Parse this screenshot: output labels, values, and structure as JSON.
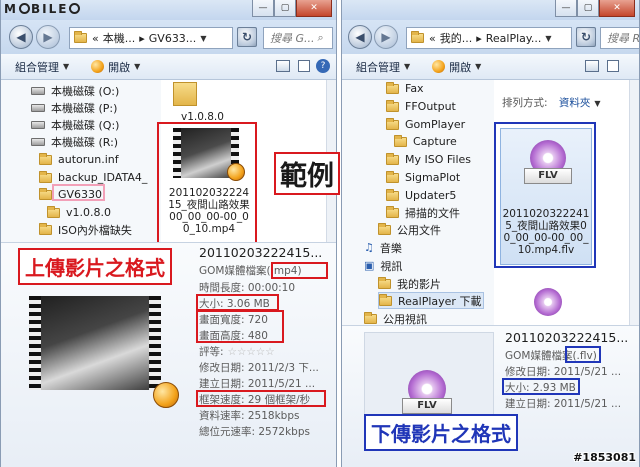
{
  "watermark": {
    "brand_pre": "M",
    "brand_post": "BILE",
    "code": "#1853081"
  },
  "left": {
    "address": {
      "part1": "本機...",
      "part2": "GV633..."
    },
    "search_placeholder": "搜尋 G...",
    "toolbar": {
      "organize": "組合管理",
      "open": "開啟"
    },
    "tree": [
      "本機磁碟 (O:)",
      "本機磁碟 (P:)",
      "本機磁碟 (Q:)",
      "本機磁碟 (R:)",
      "autorun.inf",
      "backup_IDATA4_",
      "GV6330",
      "v1.0.8.0",
      "ISO內外檔缺失"
    ],
    "content": {
      "folder_name": "v1.0.8.0",
      "file_name": "20110203222415_夜間山路效果00_00_00-00_00_10.mp4"
    },
    "details": {
      "name": "20110203222415...",
      "type": "GOM媒體檔案(.mp4)",
      "duration": "時間長度: 00:00:10",
      "size": "大小: 3.06 MB",
      "width": "畫面寬度: 720",
      "height": "畫面高度: 480",
      "rating": "評等:",
      "modified": "修改日期: 2011/2/3 下...",
      "created": "建立日期: 2011/5/21 ...",
      "framerate": "框架速度: 29 個框架/秒",
      "datarate": "資料速率: 2518kbps",
      "bitrate": "總位元速率: 2572kbps"
    }
  },
  "right": {
    "address": {
      "part1": "我的...",
      "part2": "RealPlay..."
    },
    "search_placeholder": "搜尋 R...",
    "toolbar": {
      "organize": "組合管理",
      "open": "開啟"
    },
    "sort": {
      "label": "排列方式:",
      "value": "資料夾"
    },
    "tree": [
      "Fax",
      "FFOutput",
      "GomPlayer",
      "Capture",
      "My ISO Files",
      "SigmaPlot",
      "Updater5",
      "掃描的文件",
      "公用文件",
      "音樂",
      "視訊",
      "我的影片",
      "RealPlayer 下載",
      "公用視訊"
    ],
    "content": {
      "file_name": "20110203222415_夜間山路效果00_00_00-00_00_10.mp4.flv",
      "icon_label": "FLV"
    },
    "details": {
      "name": "20110203222415...",
      "type": "GOM媒體檔案(.flv)",
      "modified": "修改日期: 2011/5/21 ...",
      "size": "大小: 2.93 MB",
      "created": "建立日期: 2011/5/21 ..."
    }
  },
  "callouts": {
    "example": "範例",
    "upload": "上傳影片之格式",
    "download": "下傳影片之格式"
  }
}
